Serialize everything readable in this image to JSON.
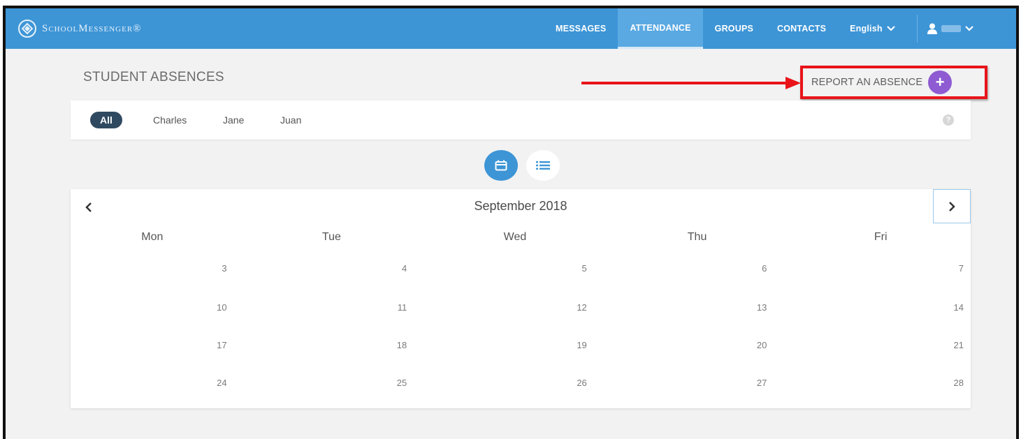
{
  "brand": {
    "name": "SchoolMessenger®"
  },
  "nav": {
    "items": [
      {
        "label": "MESSAGES",
        "active": false
      },
      {
        "label": "ATTENDANCE",
        "active": true
      },
      {
        "label": "GROUPS",
        "active": false
      },
      {
        "label": "CONTACTS",
        "active": false
      }
    ],
    "language": "English"
  },
  "page": {
    "title": "STUDENT ABSENCES",
    "report_button": "REPORT AN ABSENCE",
    "report_plus": "+"
  },
  "filters": {
    "items": [
      "All",
      "Charles",
      "Jane",
      "Juan"
    ],
    "selected": "All",
    "help": "?"
  },
  "views": {
    "selected": "calendar",
    "options": [
      "calendar-icon",
      "list-icon"
    ]
  },
  "calendar": {
    "month": "September 2018",
    "weekdays": [
      "Mon",
      "Tue",
      "Wed",
      "Thu",
      "Fri"
    ],
    "weeks": [
      [
        "3",
        "4",
        "5",
        "6",
        "7"
      ],
      [
        "10",
        "11",
        "12",
        "13",
        "14"
      ],
      [
        "17",
        "18",
        "19",
        "20",
        "21"
      ],
      [
        "24",
        "25",
        "26",
        "27",
        "28"
      ]
    ]
  },
  "colors": {
    "nav_bg": "#3d95d6",
    "accent_purple": "#8e5bd2",
    "highlight_red": "#e8141a",
    "filter_active": "#2f4a60"
  }
}
